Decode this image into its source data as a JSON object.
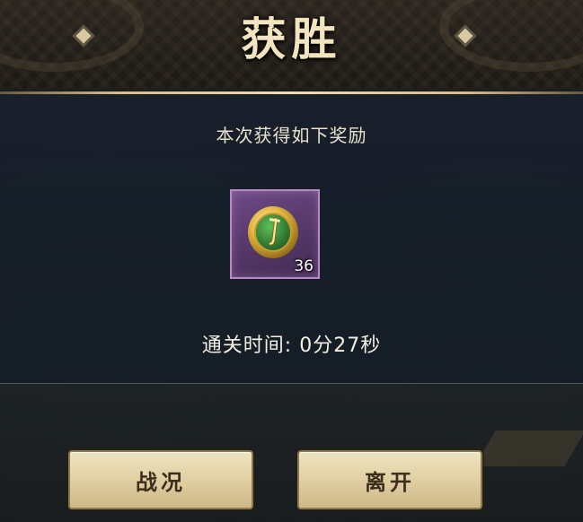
{
  "header": {
    "title": "获胜"
  },
  "reward": {
    "caption": "本次获得如下奖励",
    "item": {
      "icon": "gold-coin-sword-icon",
      "count": "36"
    }
  },
  "clear_time": "通关时间: 0分27秒",
  "buttons": {
    "battle_report": "战况",
    "leave": "离开"
  },
  "colors": {
    "title_gold": "#f1e4bf",
    "item_slot_purple": "#57396b",
    "button_cream": "#e3d2a6"
  }
}
